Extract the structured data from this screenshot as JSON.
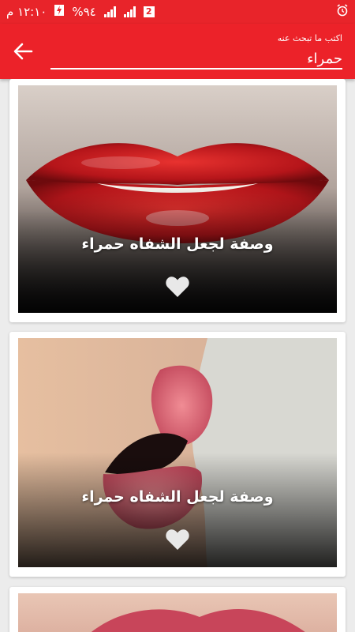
{
  "status_bar": {
    "time": "١٢:١٠ م",
    "battery": "%٩٤",
    "sim_badge": "2"
  },
  "app_bar": {
    "search_hint": "اكتب ما تبحث عنه",
    "search_value": "حمراء"
  },
  "cards": [
    {
      "title": "وصفة لجعل الشفاه حمراء",
      "icon": "heart-icon"
    },
    {
      "title": "وصفة لجعل الشفاه حمراء",
      "icon": "heart-icon"
    }
  ],
  "colors": {
    "primary": "#ec2229",
    "status_bar": "#e8242a",
    "background": "#ececec"
  }
}
